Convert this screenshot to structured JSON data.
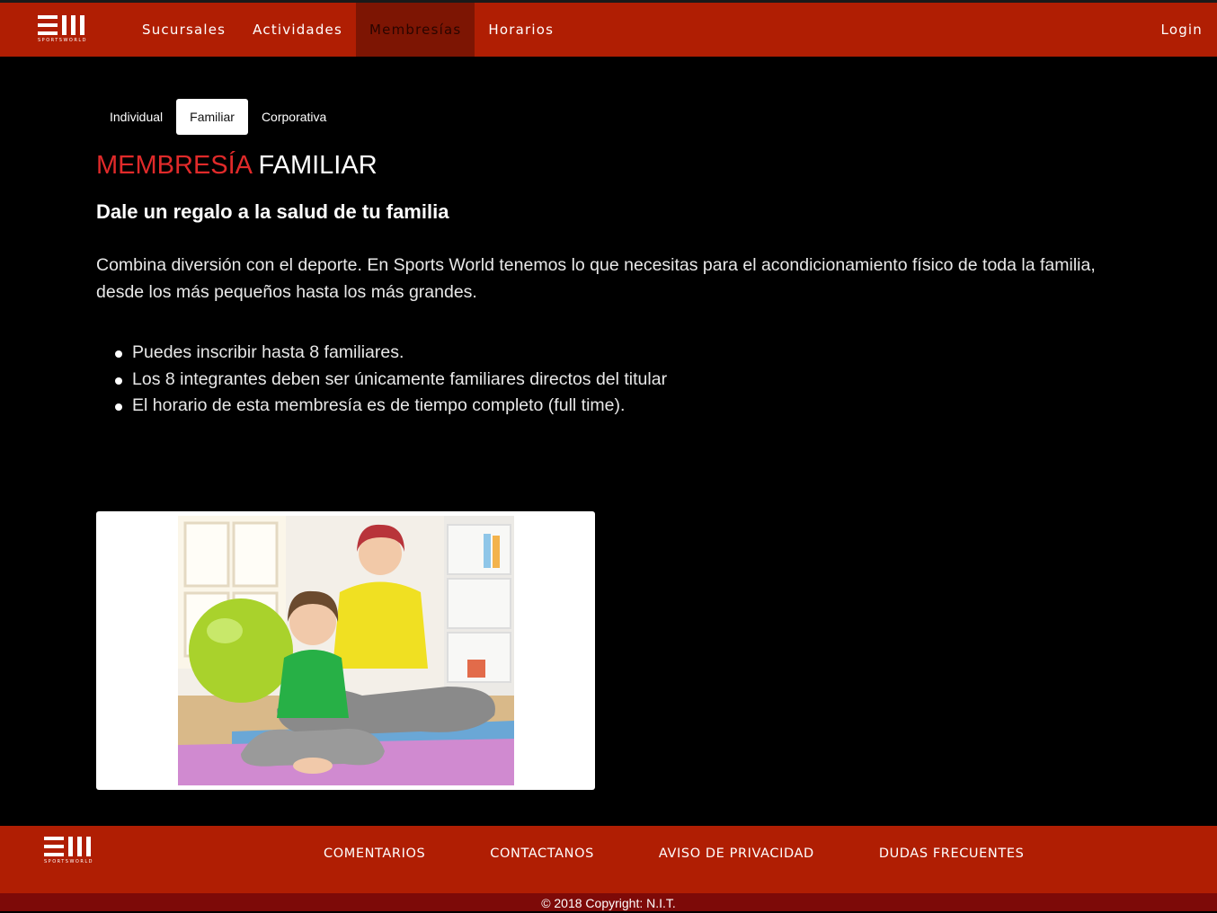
{
  "navbar": {
    "logo_text": "SPORTSWORLD",
    "items": [
      {
        "label": "Sucursales"
      },
      {
        "label": "Actividades"
      },
      {
        "label": "Membresías"
      },
      {
        "label": "Horarios"
      }
    ],
    "active": "Membresías",
    "login_label": "Login"
  },
  "tabs": [
    {
      "label": "Individual"
    },
    {
      "label": "Familiar"
    },
    {
      "label": "Corporativa"
    }
  ],
  "active_tab": "Familiar",
  "content": {
    "title_highlight": "MEMBRESÍA",
    "title_rest": "FAMILIAR",
    "subtitle": "Dale un regalo a la salud de tu familia",
    "description": "Combina diversión con el deporte. En Sports World tenemos lo que necesitas para el acondicionamiento físico de toda la familia, desde los más pequeños hasta los más grandes.",
    "features": [
      "Puedes inscribir hasta 8 familiares.",
      "Los 8 integrantes deben ser únicamente familiares directos del titular",
      "El horario de esta membresía es de tiempo completo (full time)."
    ]
  },
  "footer": {
    "logo_text": "SPORTSWORLD",
    "links": [
      {
        "label": "COMENTARIOS"
      },
      {
        "label": "CONTACTANOS"
      },
      {
        "label": "AVISO DE PRIVACIDAD"
      },
      {
        "label": "DUDAS FRECUENTES"
      }
    ],
    "copyright": "© 2018 Copyright: N.I.T."
  },
  "colors": {
    "brand_red": "#b01e03",
    "active_nav": "#7d1503",
    "title_red": "#e02a2a",
    "copyright_bar": "#7d0a08"
  }
}
